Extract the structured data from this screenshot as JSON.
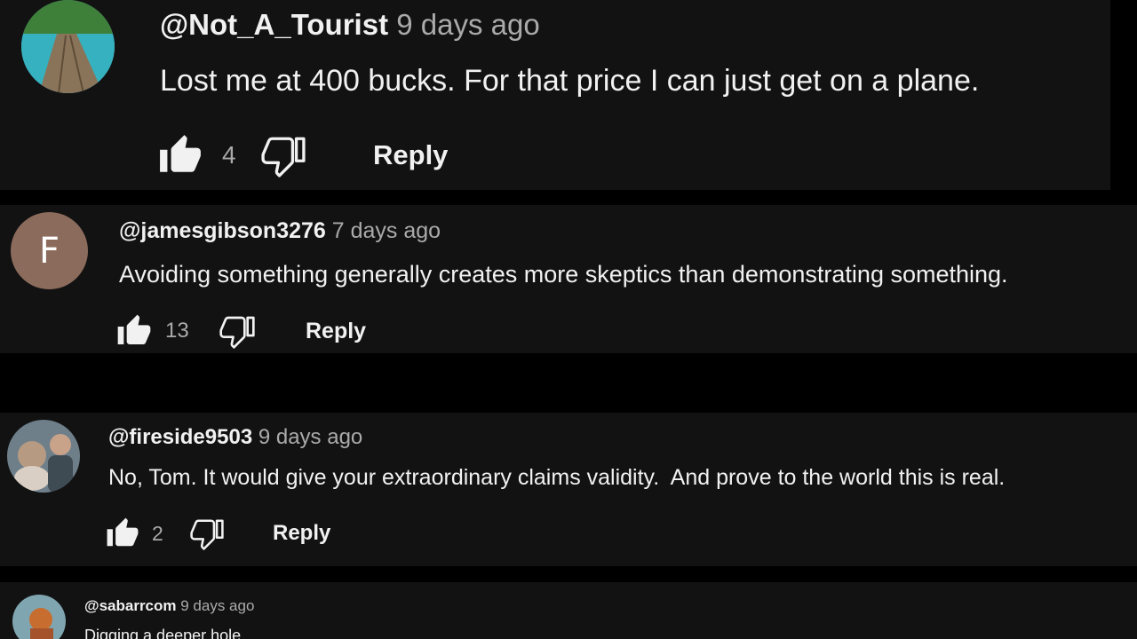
{
  "comments": [
    {
      "author": "@Not_A_Tourist",
      "time": "9 days ago",
      "text": "Lost me at 400 bucks. For that price I can just get on a plane.",
      "likes": "4",
      "reply": "Reply"
    },
    {
      "author": "@jamesgibson3276",
      "avatar_letter": "F",
      "avatar_color": "#8b6b5c",
      "time": "7 days ago",
      "text": "Avoiding something generally creates more skeptics than demonstrating something.",
      "likes": "13",
      "reply": "Reply"
    },
    {
      "author": "@fireside9503",
      "time": "9 days ago",
      "text": "No, Tom. It would give your extraordinary claims validity.  And prove to the world this is real.",
      "likes": "2",
      "reply": "Reply"
    },
    {
      "author": "@sabarrcom",
      "time": "9 days ago",
      "text": "Digging a deeper hole"
    }
  ],
  "colors": {
    "background": "#000000",
    "card": "#121212",
    "primary_text": "#f1f1f1",
    "secondary_text": "#aaaaaa"
  },
  "icons": [
    "thumbs-up-icon",
    "thumbs-down-icon"
  ]
}
